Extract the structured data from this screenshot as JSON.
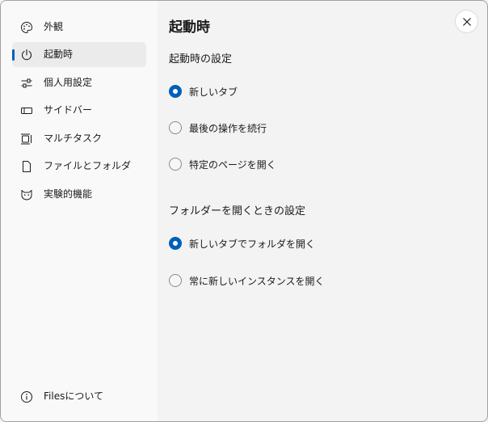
{
  "sidebar": {
    "items": [
      {
        "label": "外観",
        "icon": "palette-icon",
        "selected": false
      },
      {
        "label": "起動時",
        "icon": "power-icon",
        "selected": true
      },
      {
        "label": "個人用設定",
        "icon": "sliders-icon",
        "selected": false
      },
      {
        "label": "サイドバー",
        "icon": "sidebar-icon",
        "selected": false
      },
      {
        "label": "マルチタスク",
        "icon": "multitask-icon",
        "selected": false
      },
      {
        "label": "ファイルとフォルダ",
        "icon": "document-icon",
        "selected": false
      },
      {
        "label": "実験的機能",
        "icon": "cat-icon",
        "selected": false
      }
    ],
    "about": {
      "label": "Filesについて",
      "icon": "info-icon"
    }
  },
  "main": {
    "title": "起動時",
    "startup_section": {
      "heading": "起動時の設定",
      "options": [
        {
          "label": "新しいタブ",
          "selected": true
        },
        {
          "label": "最後の操作を続行",
          "selected": false
        },
        {
          "label": "特定のページを開く",
          "selected": false
        }
      ]
    },
    "folder_section": {
      "heading": "フォルダーを開くときの設定",
      "options": [
        {
          "label": "新しいタブでフォルダを開く",
          "selected": true
        },
        {
          "label": "常に新しいインスタンスを開く",
          "selected": false
        }
      ]
    }
  },
  "close": {
    "icon": "close-icon"
  },
  "colors": {
    "accent": "#005fb8",
    "sidebar_bg": "#f9f9f9",
    "content_bg": "#f3f3f3"
  }
}
